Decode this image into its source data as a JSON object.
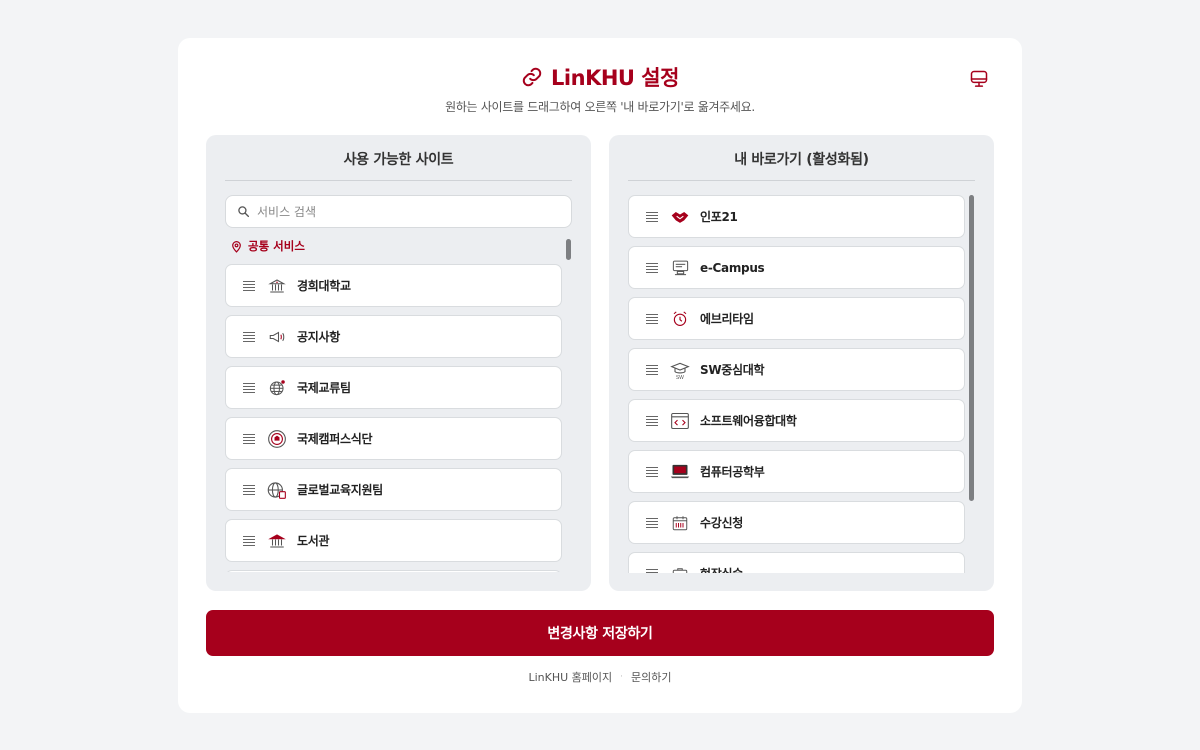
{
  "header": {
    "title": "LinKHU 설정",
    "subtitle": "원하는 사이트를 드래그하여 오른쪽 '내 바로가기'로 옮겨주세요.",
    "title_icon": "link-icon",
    "corner_icon": "monitor-icon"
  },
  "available": {
    "title": "사용 가능한 사이트",
    "search_placeholder": "서비스 검색",
    "section_label": "공통 서비스",
    "items": [
      {
        "label": "경희대학교",
        "icon": "university-building-icon"
      },
      {
        "label": "공지사항",
        "icon": "megaphone-icon"
      },
      {
        "label": "국제교류팀",
        "icon": "globe-icon"
      },
      {
        "label": "국제캠퍼스식단",
        "icon": "campus-emblem-icon"
      },
      {
        "label": "글로벌교육지원팀",
        "icon": "globe-document-icon"
      },
      {
        "label": "도서관",
        "icon": "library-building-icon"
      }
    ]
  },
  "shortcuts": {
    "title": "내 바로가기 (활성화됨)",
    "items": [
      {
        "label": "인포21",
        "icon": "handshake-icon"
      },
      {
        "label": "e-Campus",
        "icon": "e-campus-monitor-icon"
      },
      {
        "label": "에브리타임",
        "icon": "alarm-clock-icon"
      },
      {
        "label": "SW중심대학",
        "icon": "graduation-cap-icon"
      },
      {
        "label": "소프트웨어융합대학",
        "icon": "code-window-icon"
      },
      {
        "label": "컴퓨터공학부",
        "icon": "laptop-icon"
      },
      {
        "label": "수강신청",
        "icon": "calendar-icon"
      },
      {
        "label": "현장실습",
        "icon": "briefcase-icon"
      }
    ]
  },
  "save_label": "변경사항 저장하기",
  "footer": {
    "homepage_label": "LinKHU 홈페이지",
    "separator": "·",
    "contact_label": "문의하기"
  },
  "colors": {
    "brand": "#a6001c",
    "background": "#f3f4f6",
    "panel": "#eceef1"
  }
}
